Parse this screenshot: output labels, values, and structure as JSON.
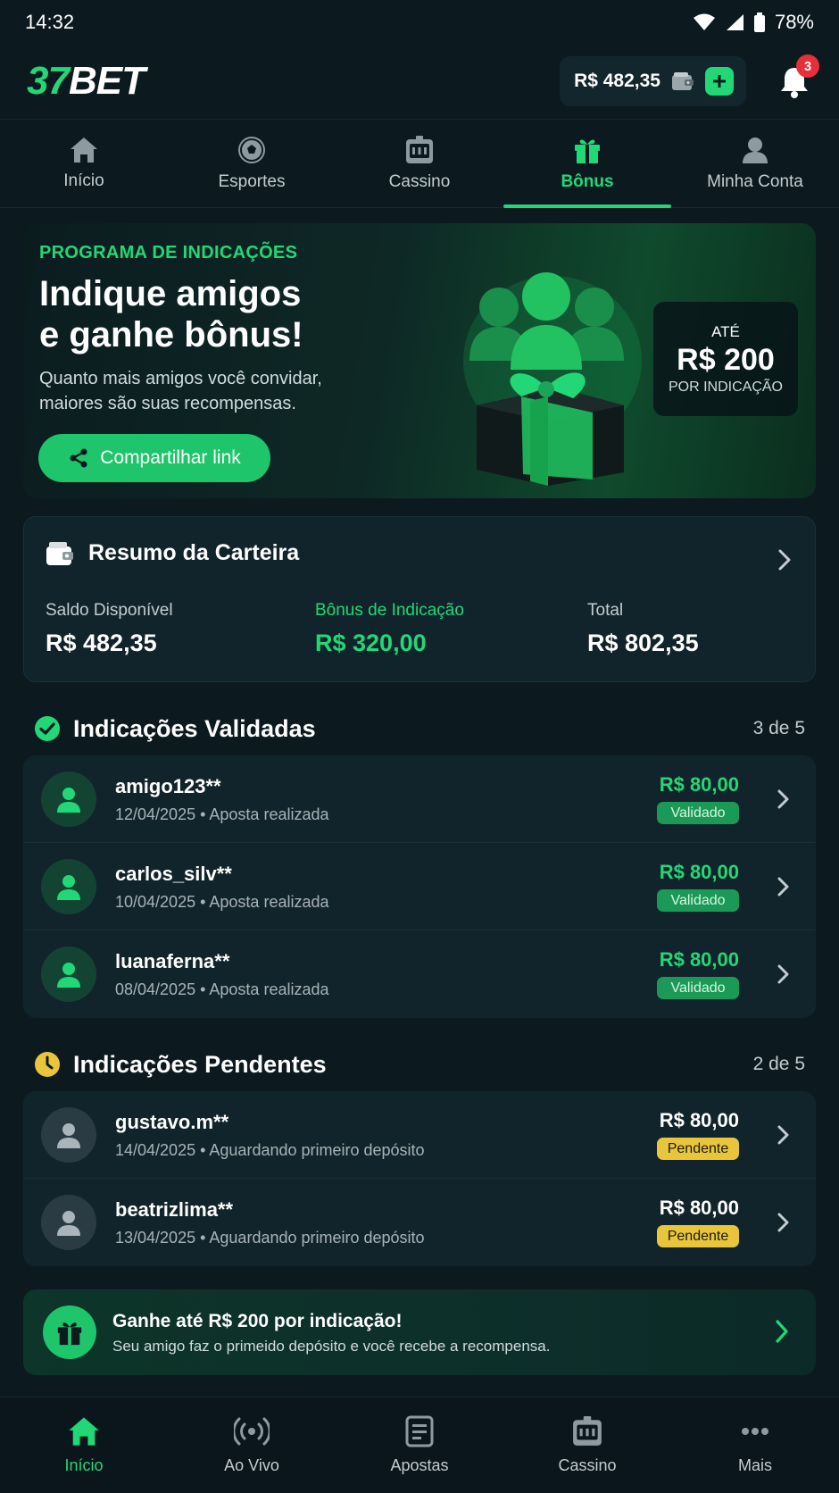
{
  "status_bar": {
    "time": "14:32",
    "battery": "78%"
  },
  "header": {
    "logo_number": "37",
    "logo_text": "BET",
    "balance": "R$ 482,35",
    "notification_count": "3"
  },
  "top_nav": [
    {
      "label": "Início",
      "icon": "home-icon",
      "active": false
    },
    {
      "label": "Esportes",
      "icon": "soccer-ball-icon",
      "active": false
    },
    {
      "label": "Cassino",
      "icon": "slot-machine-icon",
      "active": false
    },
    {
      "label": "Bônus",
      "icon": "gift-icon",
      "active": true
    },
    {
      "label": "Minha Conta",
      "icon": "user-icon",
      "active": false
    }
  ],
  "hero": {
    "eyebrow": "PROGRAMA DE INDICAÇÕES",
    "title_line1": "Indique amigos",
    "title_line2": "e ganhe bônus!",
    "subtitle_line1": "Quanto mais amigos você convidar,",
    "subtitle_line2": "maiores são suas recompensas.",
    "share_label": "Compartilhar link",
    "reward_pre": "ATÉ",
    "reward_amount": "R$ 200",
    "reward_post": "POR INDICAÇÃO"
  },
  "wallet": {
    "title": "Resumo da Carteira",
    "available_label": "Saldo Disponível",
    "available_value": "R$ 482,35",
    "bonus_label": "Bônus de Indicação",
    "bonus_value": "R$ 320,00",
    "total_label": "Total",
    "total_value": "R$ 802,35"
  },
  "validated": {
    "title": "Indicações Validadas",
    "count": "3 de 5",
    "items": [
      {
        "name": "amigo123**",
        "date": "12/04/2025",
        "status_text": "Aposta realizada",
        "amount": "R$ 80,00",
        "badge": "Validado"
      },
      {
        "name": "carlos_silv**",
        "date": "10/04/2025",
        "status_text": "Aposta realizada",
        "amount": "R$ 80,00",
        "badge": "Validado"
      },
      {
        "name": "luanaferna**",
        "date": "08/04/2025",
        "status_text": "Aposta realizada",
        "amount": "R$ 80,00",
        "badge": "Validado"
      }
    ]
  },
  "pending": {
    "title": "Indicações Pendentes",
    "count": "2 de 5",
    "items": [
      {
        "name": "gustavo.m**",
        "date": "14/04/2025",
        "status_text": "Aguardando primeiro depósito",
        "amount": "R$ 80,00",
        "badge": "Pendente"
      },
      {
        "name": "beatrizlima**",
        "date": "13/04/2025",
        "status_text": "Aguardando primeiro depósito",
        "amount": "R$ 80,00",
        "badge": "Pendente"
      }
    ]
  },
  "promo": {
    "title": "Ganhe até R$ 200 por indicação!",
    "subtitle": "Seu amigo faz o primeido depósito e você recebe a recompensa."
  },
  "bottom_nav": [
    {
      "label": "Início",
      "icon": "home-icon",
      "active": true
    },
    {
      "label": "Ao Vivo",
      "icon": "live-broadcast-icon",
      "active": false
    },
    {
      "label": "Apostas",
      "icon": "bet-slip-icon",
      "active": false
    },
    {
      "label": "Cassino",
      "icon": "slot-machine-icon",
      "active": false
    },
    {
      "label": "Mais",
      "icon": "more-dots-icon",
      "active": false
    }
  ],
  "colors": {
    "background": "#0c1a20",
    "accent": "#22d876",
    "card": "#12242b",
    "pending": "#e9c53b",
    "notification": "#e5303a"
  }
}
